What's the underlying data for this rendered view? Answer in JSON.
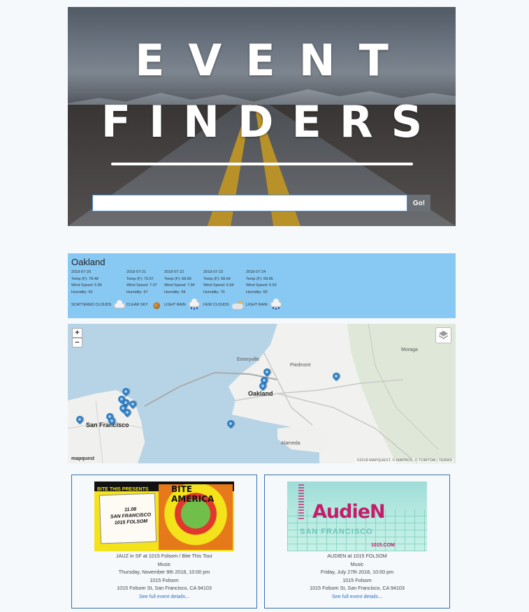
{
  "hero": {
    "title_line1": "EVENT",
    "title_line2": "FINDERS",
    "search_value": "",
    "search_button": "Go!"
  },
  "weather": {
    "city": "Oakland",
    "days": [
      {
        "date": "2018-07-20",
        "temp": "Temp (F): 78.48",
        "wind": "Wind Speed: 5.95",
        "humidity": "Humidity: 63"
      },
      {
        "date": "2018-07-21",
        "temp": "Temp (F): 70.67",
        "wind": "Wind Speed: 7.07",
        "humidity": "Humidity: 67"
      },
      {
        "date": "2018-07-22",
        "temp": "Temp (F): 68.89",
        "wind": "Wind Speed: 7.94",
        "humidity": "Humidity: 69"
      },
      {
        "date": "2018-07-23",
        "temp": "Temp (F): 68.64",
        "wind": "Wind Speed: 6.64",
        "humidity": "Humidity: 70"
      },
      {
        "date": "2018-07-24",
        "temp": "Temp (F): 68.85",
        "wind": "Wind Speed: 6.53",
        "humidity": "Humidity: 69"
      }
    ],
    "conditions": [
      {
        "label": "SCATTERED CLOUDS",
        "icon": "scattered-clouds-icon"
      },
      {
        "label": "CLEAR SKY",
        "icon": "clear-sky-icon"
      },
      {
        "label": "LIGHT RAIN",
        "icon": "light-rain-icon"
      },
      {
        "label": "FEW CLOUDS",
        "icon": "few-clouds-icon"
      },
      {
        "label": "LIGHT RAIN",
        "icon": "light-rain-icon"
      }
    ]
  },
  "map": {
    "zoom_in": "+",
    "zoom_out": "−",
    "labels": {
      "sf": "San Francisco",
      "oakland": "Oakland",
      "alameda": "Alameda",
      "emeryville": "Emeryville",
      "piedmont": "Piedmont",
      "moraga": "Moraga"
    },
    "logo": "mapquest",
    "attribution": "©2018 MAPQUEST, © MAPBOX, © TOMTOM | TERMS"
  },
  "events": [
    {
      "title": "JAUZ in SF at 1015 Folsom / Bite This Tour",
      "genre": "Music",
      "datetime": "Thursday, November 8th 2018, 10:00 pm",
      "venue": "1015 Folsom",
      "address": "1015 Folsom St, San Francisco, CA 94103",
      "link": "See full event details...",
      "image": {
        "top": "BITE THIS PRESENTS",
        "banner": "BITE AMERICA",
        "date": "11.08",
        "city": "SAN FRANCISCO",
        "venue": "1015 FOLSOM"
      }
    },
    {
      "title": "AUDIEN at 1015 FOLSOM",
      "genre": "Music",
      "datetime": "Friday, July 27th 2018, 10:00 pm",
      "venue": "1015 Folsom",
      "address": "1015 Folsom St, San Francisco, CA 94103",
      "link": "See full event details...",
      "image": {
        "name": "AudieN",
        "city": "SAN FRANCISCO",
        "url": "1015.COM"
      }
    }
  ]
}
